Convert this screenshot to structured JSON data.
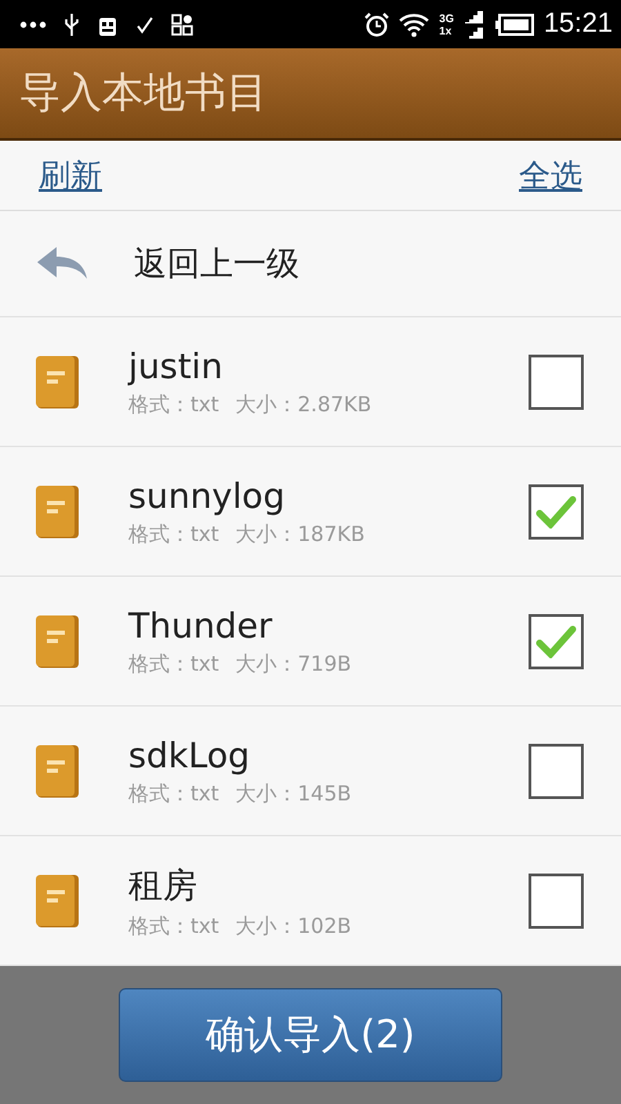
{
  "status_bar": {
    "network_top": "3G",
    "network_bottom": "1x",
    "time": "15:21"
  },
  "title_bar": {
    "title": "导入本地书目"
  },
  "toolbar": {
    "refresh": "刷新",
    "select_all": "全选"
  },
  "back_row": {
    "label": "返回上一级"
  },
  "files": [
    {
      "name": "justin",
      "format_label": "格式：txt",
      "size_label": "大小：2.87KB",
      "checked": false
    },
    {
      "name": "sunnylog",
      "format_label": "格式：txt",
      "size_label": "大小：187KB",
      "checked": true
    },
    {
      "name": "Thunder",
      "format_label": "格式：txt",
      "size_label": "大小：719B",
      "checked": true
    },
    {
      "name": "sdkLog",
      "format_label": "格式：txt",
      "size_label": "大小：145B",
      "checked": false
    },
    {
      "name": "租房",
      "format_label": "格式：txt",
      "size_label": "大小：102B",
      "checked": false
    }
  ],
  "confirm_button": {
    "label": "确认导入(2)"
  }
}
